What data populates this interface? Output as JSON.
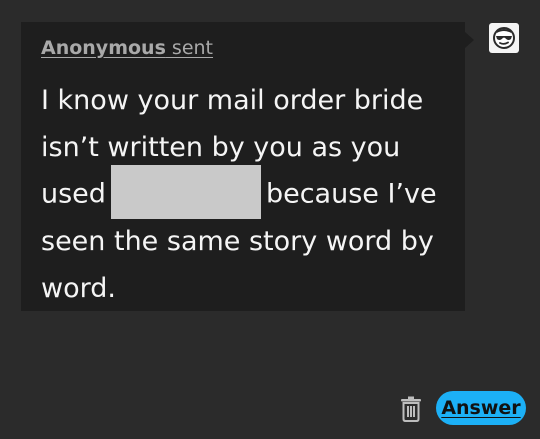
{
  "ask": {
    "sender_name": "Anonymous",
    "sender_suffix": " sent",
    "message_lines": [
      "I know your mail order bride",
      "isn’t written by you as you",
      "used",
      "because I’ve",
      "seen the same story word by",
      "word."
    ]
  },
  "actions": {
    "answer_label": "Answer",
    "delete_icon": "trash-icon"
  },
  "avatar": {
    "icon": "sunglasses-face-icon"
  },
  "colors": {
    "background": "#2b2b2b",
    "bubble": "#1e1e1e",
    "text": "#f5f5f5",
    "muted_text": "#a9a9a9",
    "accent": "#1cb0f6",
    "redaction": "#c9c9c9"
  }
}
